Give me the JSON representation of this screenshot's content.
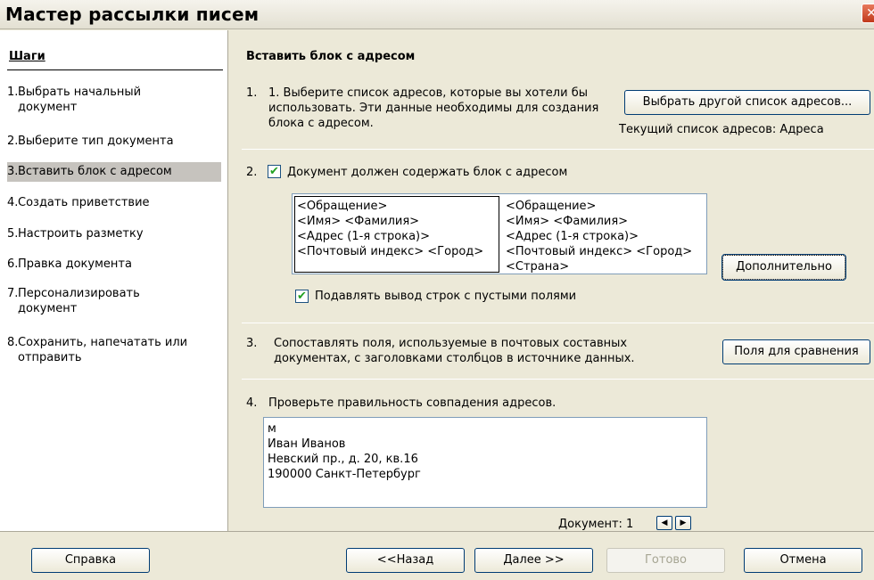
{
  "window": {
    "title": "Мастер рассылки писем",
    "close_symbol": "✕"
  },
  "steps": {
    "title": "Шаги",
    "items": [
      {
        "num": "1.",
        "label": "Выбрать начальный документ"
      },
      {
        "num": "2.",
        "label": "Выберите тип документа"
      },
      {
        "num": "3.",
        "label": "Вставить блок с адресом"
      },
      {
        "num": "4.",
        "label": "Создать приветствие"
      },
      {
        "num": "5.",
        "label": "Настроить разметку"
      },
      {
        "num": "6.",
        "label": "Правка документа"
      },
      {
        "num": "7.",
        "label": "Персонализировать документ"
      },
      {
        "num": "8.",
        "label": "Сохранить, напечатать или отправить"
      }
    ],
    "active_index": 2
  },
  "main": {
    "heading": "Вставить блок с адресом",
    "section1": {
      "num": "1.",
      "text": "1. Выберите список адресов, которые вы хотели бы использовать. Эти данные необходимы для создания блока с адресом.",
      "button": "Выбрать другой список адресов...",
      "current_list": "Текущий список адресов: Адреса"
    },
    "section2": {
      "num": "2.",
      "checkbox_label": "Документ должен содержать блок с адресом",
      "checkbox_checked": true,
      "block1_lines": [
        "<Обращение>",
        "<Имя> <Фамилия>",
        "<Адрес (1-я строка)>",
        "<Почтовый индекс> <Город>"
      ],
      "block2_lines": [
        "<Обращение>",
        "<Имя> <Фамилия>",
        "<Адрес (1-я строка)>",
        "<Почтовый индекс> <Город>",
        "<Страна>"
      ],
      "more_button": "Дополнительно",
      "suppress_label": "Подавлять вывод строк с пустыми полями",
      "suppress_checked": true
    },
    "section3": {
      "num": "3.",
      "text": "Сопоставлять поля, используемые в почтовых составных документах, с заголовками столбцов в источнике данных.",
      "button": "Поля для сравнения"
    },
    "section4": {
      "num": "4.",
      "text": "Проверьте правильность совпадения адресов.",
      "preview_lines": [
        "м",
        "Иван Иванов",
        "Невский пр., д. 20, кв.16",
        "190000 Санкт-Петербург"
      ],
      "document_label": "Документ: 1",
      "prev_symbol": "◀",
      "next_symbol": "▶"
    }
  },
  "footer": {
    "help": "Справка",
    "back": "<<Назад",
    "next": "Далее >>",
    "finish": "Готово",
    "cancel": "Отмена"
  }
}
